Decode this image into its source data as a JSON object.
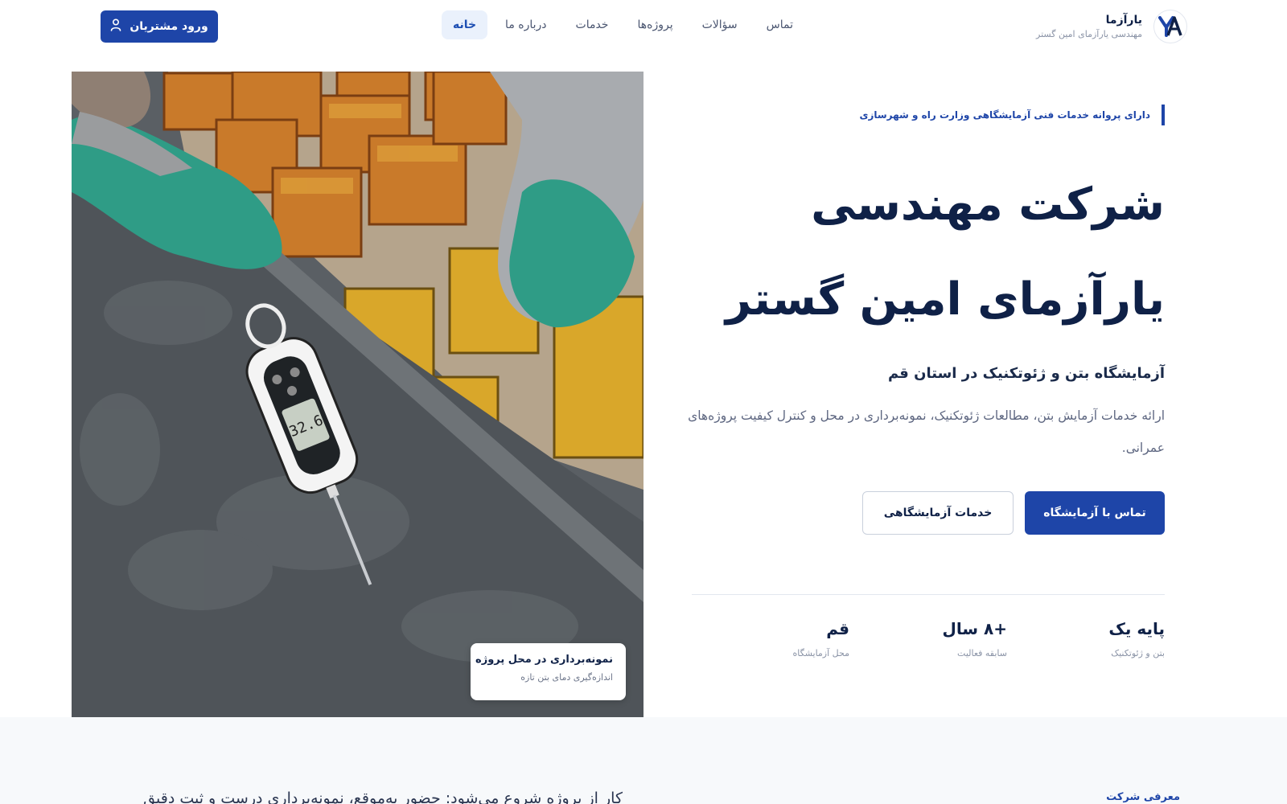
{
  "brand": {
    "name": "یارآزما",
    "tagline": "مهندسی یارآزمای امین گستر",
    "logo_icon": "ya-monogram-logo"
  },
  "nav": {
    "items": [
      {
        "label": "خانه",
        "active": true
      },
      {
        "label": "درباره ما",
        "active": false
      },
      {
        "label": "خدمات",
        "active": false
      },
      {
        "label": "پروژه‌ها",
        "active": false
      },
      {
        "label": "سؤالات",
        "active": false
      },
      {
        "label": "تماس",
        "active": false
      }
    ]
  },
  "login": {
    "label": "ورود مشتریان",
    "icon": "user-icon"
  },
  "hero": {
    "license": "دارای پروانه خدمات فنی آزمایشگاهی وزارت راه و شهرسازی",
    "title_line1": "شرکت مهندسی",
    "title_line2": "یارآزمای امین گستر",
    "subtitle": "آزمایشگاه بتن و ژئوتکنیک در استان قم",
    "description": "ارائه خدمات آزمایش بتن، مطالعات ژئوتکنیک، نمونه‌برداری در محل و کنترل کیفیت پروژه‌های عمرانی.",
    "primary_button": "تماس با آزمایشگاه",
    "secondary_button": "خدمات آزمایشگاهی",
    "image_caption_title": "نمونه‌برداری در محل پروژه",
    "image_caption_sub": "اندازه‌گیری دمای بتن تازه"
  },
  "stats": [
    {
      "value": "پایه یک",
      "label": "بتن و ژئوتکنیک"
    },
    {
      "value": "+۸ سال",
      "label": "سابقه فعالیت"
    },
    {
      "value": "قم",
      "label": "محل آزمایشگاه"
    }
  ],
  "intro": {
    "label": "معرفی شرکت",
    "text": "کار از پروژه شروع می‌شود: حضور به‌موقع، نمونه‌برداری درست و ثبت دقیق"
  },
  "colors": {
    "primary": "#1e45a8",
    "dark_navy": "#0f2147",
    "active_nav_bg": "#eaf1fc"
  }
}
